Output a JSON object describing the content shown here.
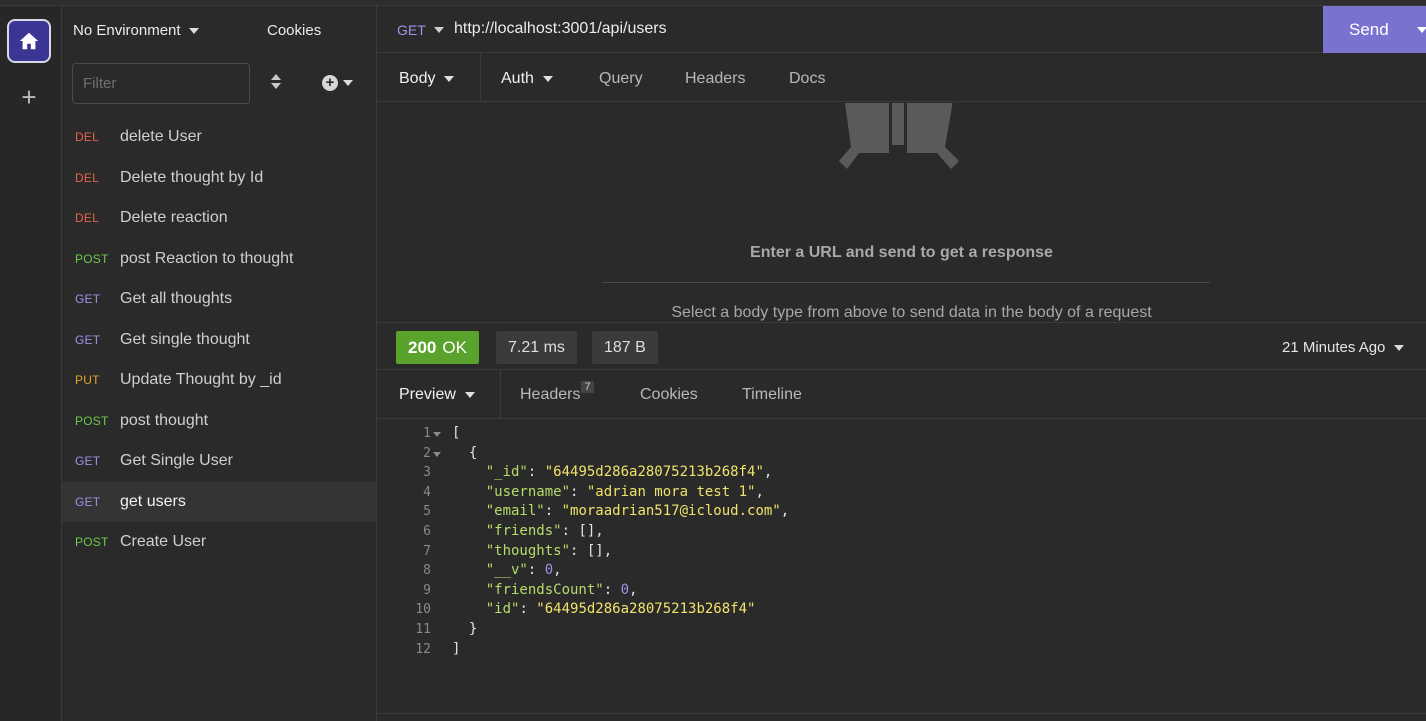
{
  "rail": {
    "home_icon": "home-icon",
    "add_icon": "plus-icon",
    "add_label": "+"
  },
  "sidebar": {
    "environment": "No Environment",
    "cookies": "Cookies",
    "filter_placeholder": "Filter",
    "requests": [
      {
        "method": "DEL",
        "name": "delete User"
      },
      {
        "method": "DEL",
        "name": "Delete thought by Id"
      },
      {
        "method": "DEL",
        "name": "Delete reaction"
      },
      {
        "method": "POST",
        "name": "post Reaction to thought"
      },
      {
        "method": "GET",
        "name": "Get all thoughts"
      },
      {
        "method": "GET",
        "name": "Get single thought"
      },
      {
        "method": "PUT",
        "name": "Update Thought by _id"
      },
      {
        "method": "POST",
        "name": "post thought"
      },
      {
        "method": "GET",
        "name": "Get Single User"
      },
      {
        "method": "GET",
        "name": "get users",
        "active": true
      },
      {
        "method": "POST",
        "name": "Create User"
      }
    ]
  },
  "request": {
    "method": "GET",
    "url": "http://localhost:3001/api/users",
    "send_label": "Send",
    "tabs": [
      "Body",
      "Auth",
      "Query",
      "Headers",
      "Docs"
    ],
    "empty_title": "Enter a URL and send to get a response",
    "empty_subtitle": "Select a body type from above to send data in the body of a request"
  },
  "response": {
    "status": "200",
    "status_text": "OK",
    "time": "7.21 ms",
    "size": "187 B",
    "time_ago": "21 Minutes Ago",
    "tabs": [
      "Preview",
      "Headers",
      "Cookies",
      "Timeline"
    ],
    "headers_count": "7",
    "code_lines": [
      {
        "n": "1",
        "fold": true,
        "text": "["
      },
      {
        "n": "2",
        "fold": true,
        "text": "  {"
      },
      {
        "n": "3",
        "key": "_id",
        "value": "\"64495d286a28075213b268f4\"",
        "vtype": "s",
        "comma": true
      },
      {
        "n": "4",
        "key": "username",
        "value": "\"adrian mora test 1\"",
        "vtype": "s",
        "comma": true
      },
      {
        "n": "5",
        "key": "email",
        "value": "\"moraadrian517@icloud.com\"",
        "vtype": "s",
        "comma": true
      },
      {
        "n": "6",
        "key": "friends",
        "value": "[]",
        "vtype": "p",
        "comma": true
      },
      {
        "n": "7",
        "key": "thoughts",
        "value": "[]",
        "vtype": "p",
        "comma": true
      },
      {
        "n": "8",
        "key": "__v",
        "value": "0",
        "vtype": "n",
        "comma": true
      },
      {
        "n": "9",
        "key": "friendsCount",
        "value": "0",
        "vtype": "n",
        "comma": true
      },
      {
        "n": "10",
        "key": "id",
        "value": "\"64495d286a28075213b268f4\"",
        "vtype": "s",
        "comma": false
      },
      {
        "n": "11",
        "text": "  }"
      },
      {
        "n": "12",
        "text": "]"
      }
    ]
  }
}
